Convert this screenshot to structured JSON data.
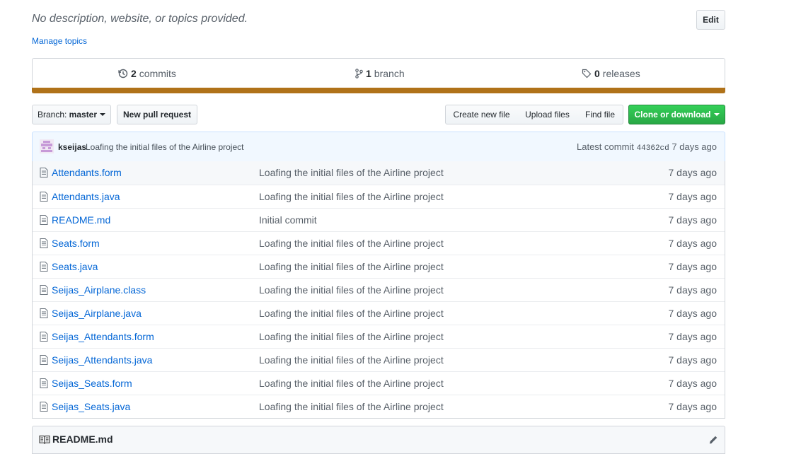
{
  "repo": {
    "description": "No description, website, or topics provided.",
    "manage_topics": "Manage topics",
    "edit_label": "Edit"
  },
  "numbers": {
    "commits_count": "2",
    "commits_label": "commits",
    "branch_count": "1",
    "branch_label": "branch",
    "releases_count": "0",
    "releases_label": "releases",
    "language_color": "#b07219"
  },
  "toolbar": {
    "branch_prefix": "Branch:",
    "branch_name": "master",
    "new_pr": "New pull request",
    "create_file": "Create new file",
    "upload_files": "Upload files",
    "find_file": "Find file",
    "clone": "Clone or download"
  },
  "latest_commit": {
    "author": "kseijas",
    "message": "Loafing the initial files of the Airline project",
    "prefix": "Latest commit",
    "sha": "44362cd",
    "age": "7 days ago"
  },
  "files": [
    {
      "name": "Attendants.form",
      "message": "Loafing the initial files of the Airline project",
      "age": "7 days ago"
    },
    {
      "name": "Attendants.java",
      "message": "Loafing the initial files of the Airline project",
      "age": "7 days ago"
    },
    {
      "name": "README.md",
      "message": "Initial commit",
      "age": "7 days ago"
    },
    {
      "name": "Seats.form",
      "message": "Loafing the initial files of the Airline project",
      "age": "7 days ago"
    },
    {
      "name": "Seats.java",
      "message": "Loafing the initial files of the Airline project",
      "age": "7 days ago"
    },
    {
      "name": "Seijas_Airplane.class",
      "message": "Loafing the initial files of the Airline project",
      "age": "7 days ago"
    },
    {
      "name": "Seijas_Airplane.java",
      "message": "Loafing the initial files of the Airline project",
      "age": "7 days ago"
    },
    {
      "name": "Seijas_Attendants.form",
      "message": "Loafing the initial files of the Airline project",
      "age": "7 days ago"
    },
    {
      "name": "Seijas_Attendants.java",
      "message": "Loafing the initial files of the Airline project",
      "age": "7 days ago"
    },
    {
      "name": "Seijas_Seats.form",
      "message": "Loafing the initial files of the Airline project",
      "age": "7 days ago"
    },
    {
      "name": "Seijas_Seats.java",
      "message": "Loafing the initial files of the Airline project",
      "age": "7 days ago"
    }
  ],
  "readme": {
    "title": "README.md"
  },
  "icons": [
    "history-icon",
    "git-branch-icon",
    "tag-icon",
    "file-icon",
    "book-icon",
    "pencil-icon",
    "avatar"
  ]
}
